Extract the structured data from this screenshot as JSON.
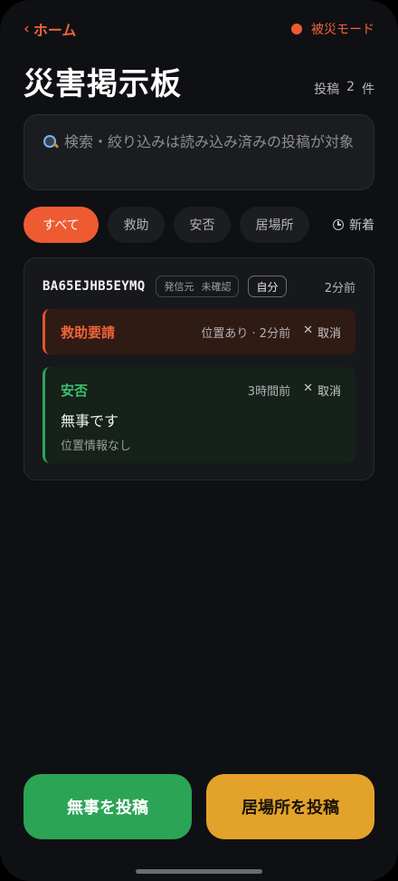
{
  "nav": {
    "back_label": "ホーム",
    "mode_label": "被災モード",
    "mode_dot_color": "#ee5a32"
  },
  "header": {
    "title": "災害掲示板",
    "count_label": "投稿",
    "count_value": "2",
    "count_unit": "件"
  },
  "search": {
    "placeholder": "検索・絞り込みは読み込み済みの投稿が対象"
  },
  "filters": {
    "tabs": [
      {
        "label": "すべて",
        "active": true
      },
      {
        "label": "救助",
        "active": false
      },
      {
        "label": "安否",
        "active": false
      },
      {
        "label": "居場所",
        "active": false
      }
    ],
    "sort_label": "新着"
  },
  "card": {
    "device_id": "BA65EJHB5EYMQ",
    "source_label": "発信元",
    "verification_label": "未確認",
    "self_label": "自分",
    "time": "2分前",
    "posts": [
      {
        "kind": "救助要請",
        "meta": "位置あり · 2分前",
        "cancel_label": "取消",
        "accent": "#e2542e"
      },
      {
        "kind": "安否",
        "meta": "3時間前",
        "cancel_label": "取消",
        "message": "無事です",
        "location": "位置情報なし",
        "accent": "#2da55a"
      }
    ]
  },
  "actions": {
    "safe_label": "無事を投稿",
    "place_label": "居場所を投稿"
  },
  "colors": {
    "accent": "#ee5a32",
    "safe": "#2ba456",
    "place": "#e3a32a",
    "background": "#0f1013"
  }
}
